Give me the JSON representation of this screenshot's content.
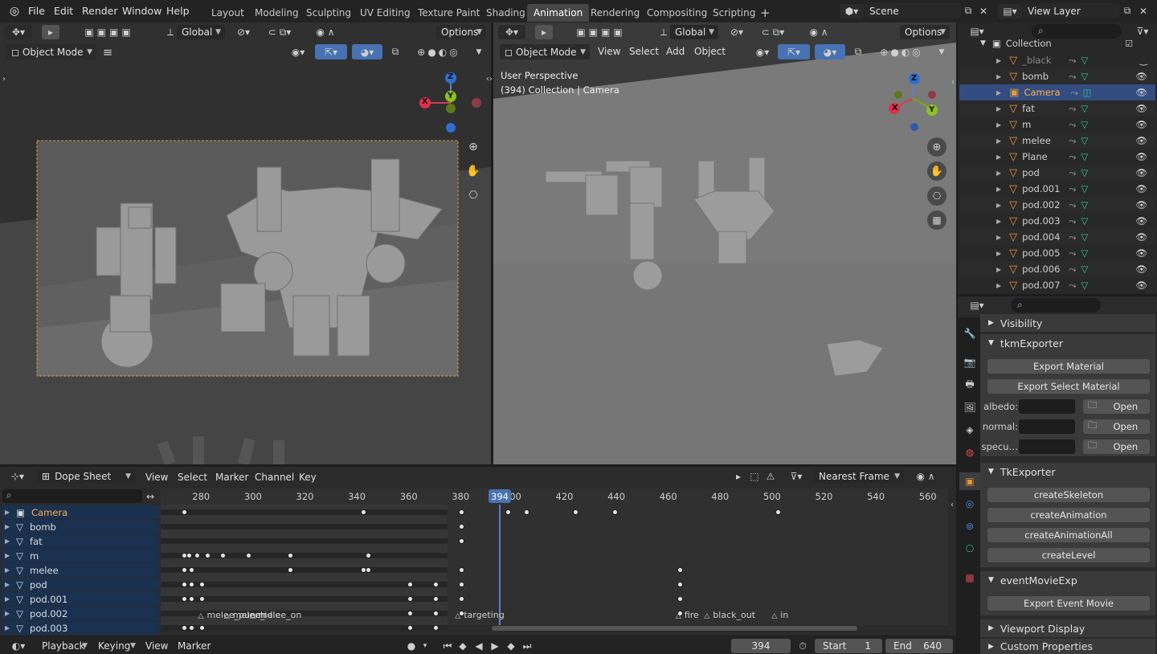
{
  "topbar": {
    "menus": [
      "File",
      "Edit",
      "Render",
      "Window",
      "Help"
    ],
    "workspaces": [
      "Layout",
      "Modeling",
      "Sculpting",
      "UV Editing",
      "Texture Paint",
      "Shading",
      "Animation",
      "Rendering",
      "Compositing",
      "Scripting"
    ],
    "active_workspace": "Animation",
    "add_tab": "+",
    "scene": "Scene",
    "view_layer": "View Layer"
  },
  "viewport_left": {
    "transform": "Global",
    "options": "Options",
    "mode": "Object Mode"
  },
  "viewport_right": {
    "transform": "Global",
    "options": "Options",
    "mode": "Object Mode",
    "menus": [
      "View",
      "Select",
      "Add",
      "Object"
    ],
    "overlay_line1": "User Perspective",
    "overlay_line2": "(394) Collection | Camera"
  },
  "gizmo": {
    "x": "X",
    "y": "Y",
    "z": "Z"
  },
  "outliner": {
    "search_placeholder": "",
    "collection": "Collection",
    "items": [
      {
        "name": "_black",
        "dim": true
      },
      {
        "name": "bomb"
      },
      {
        "name": "Camera",
        "selected": true
      },
      {
        "name": "fat"
      },
      {
        "name": "m"
      },
      {
        "name": "melee"
      },
      {
        "name": "Plane"
      },
      {
        "name": "pod"
      },
      {
        "name": "pod.001"
      },
      {
        "name": "pod.002"
      },
      {
        "name": "pod.003"
      },
      {
        "name": "pod.004"
      },
      {
        "name": "pod.005"
      },
      {
        "name": "pod.006"
      },
      {
        "name": "pod.007"
      }
    ]
  },
  "properties": {
    "sections": {
      "visibility": "Visibility",
      "tkm": "tkmExporter",
      "tk": "TkExporter",
      "event": "eventMovieExp",
      "viewport_display": "Viewport Display",
      "custom_props": "Custom Properties"
    },
    "export_material": "Export Material",
    "export_select_material": "Export Select Material",
    "fields": [
      {
        "label": "albedo:",
        "button": "Open"
      },
      {
        "label": "normal:",
        "button": "Open"
      },
      {
        "label": "specu…",
        "button": "Open"
      }
    ],
    "tk_buttons": [
      "createSkeleton",
      "createAnimation",
      "createAnimationAll",
      "createLevel"
    ],
    "export_event_movie": "Export Event Movie"
  },
  "dopesheet": {
    "editor": "Dope Sheet",
    "menus": [
      "View",
      "Select",
      "Marker",
      "Channel",
      "Key"
    ],
    "snap": "Nearest Frame",
    "current_frame": "394",
    "ticks": [
      "280",
      "300",
      "320",
      "340",
      "360",
      "380",
      "400",
      "420",
      "440",
      "460",
      "480",
      "500",
      "520",
      "540",
      "560"
    ],
    "channels": [
      "Camera",
      "bomb",
      "fat",
      "m",
      "melee",
      "pod",
      "pod.001",
      "pod.002",
      "pod.003"
    ],
    "markers": [
      "melee_punch",
      "melee_idle",
      "melee_on",
      "targeting",
      "fire",
      "black_out",
      "in"
    ]
  },
  "timeline": {
    "playback": "Playback",
    "keying": "Keying",
    "view": "View",
    "marker": "Marker",
    "frame": "394",
    "start_label": "Start",
    "start": "1",
    "end_label": "End",
    "end": "640"
  }
}
